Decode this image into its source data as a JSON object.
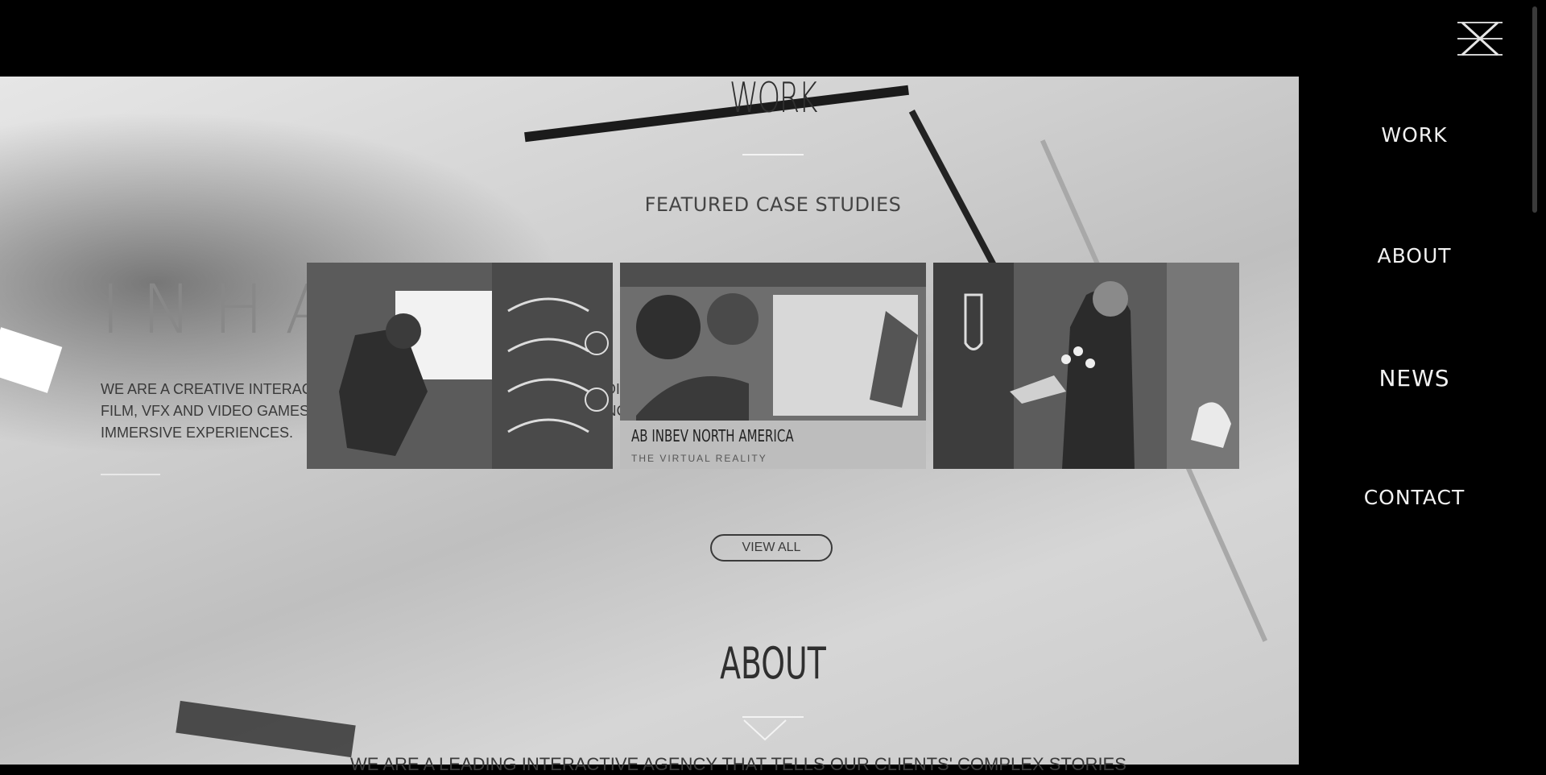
{
  "nav": {
    "items": [
      {
        "label": "WORK"
      },
      {
        "label": "ABOUT"
      },
      {
        "label": "NEWS"
      },
      {
        "label": "CONTACT"
      }
    ]
  },
  "hero": {
    "brand": "INHANCE",
    "tagline": "WE ARE A CREATIVE INTERACTIVE AGENCY THAT BRINGS THE BEST IN DIGITAL TECHNOLOGY FROM FILM, VFX AND VIDEO GAMES TO TRANSFORM YOUR MESSAGES INTO INCREDIBLE, TANGIBLE, IMMERSIVE EXPERIENCES."
  },
  "work": {
    "title": "WORK",
    "subtitle": "FEATURED CASE STUDIES",
    "cards": [
      {
        "name": "case-study-1"
      },
      {
        "name": "case-study-2",
        "title": "AB INBEV NORTH AMERICA",
        "subtitle": "THE VIRTUAL REALITY"
      },
      {
        "name": "case-study-3"
      }
    ],
    "view_all_label": "VIEW ALL"
  },
  "about": {
    "title": "ABOUT",
    "text": "WE ARE A LEADING INTERACTIVE AGENCY THAT TELLS OUR CLIENTS' COMPLEX STORIES"
  },
  "icons": {
    "menu": "close-menu-icon",
    "scroll": "chevron-down-icon"
  }
}
